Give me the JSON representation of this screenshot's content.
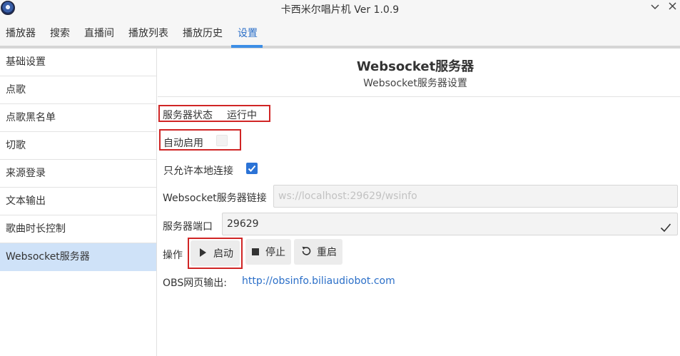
{
  "window": {
    "title": "卡西米尔唱片机 Ver 1.0.9",
    "logo_icon": "app-logo-icon"
  },
  "tabs": [
    {
      "label": "播放器"
    },
    {
      "label": "搜索"
    },
    {
      "label": "直播间"
    },
    {
      "label": "播放列表"
    },
    {
      "label": "播放历史"
    },
    {
      "label": "设置"
    }
  ],
  "sidebar": {
    "items": [
      {
        "label": "基础设置"
      },
      {
        "label": "点歌"
      },
      {
        "label": "点歌黑名单"
      },
      {
        "label": "切歌"
      },
      {
        "label": "来源登录"
      },
      {
        "label": "文本输出"
      },
      {
        "label": "歌曲时长控制"
      },
      {
        "label": "Websocket服务器"
      }
    ],
    "active_index": 7
  },
  "main": {
    "title": "Websocket服务器",
    "subtitle": "Websocket服务器设置",
    "status_label": "服务器状态",
    "status_value": "运行中",
    "autostart_label": "自动启用",
    "autostart_checked": false,
    "local_only_label": "只允许本地连接",
    "local_only_checked": true,
    "link_label": "Websocket服务器链接",
    "link_placeholder": "ws://localhost:29629/wsinfo",
    "port_label": "服务器端口",
    "port_value": "29629",
    "actions_label": "操作",
    "start_label": "启动",
    "stop_label": "停止",
    "restart_label": "重启",
    "obs_label": "OBS网页输出:",
    "obs_link": "http://obsinfo.biliaudiobot.com"
  },
  "colors": {
    "accent": "#2b6fc8",
    "highlight_box": "#d02525",
    "selected_bg": "#cfe2f8"
  }
}
